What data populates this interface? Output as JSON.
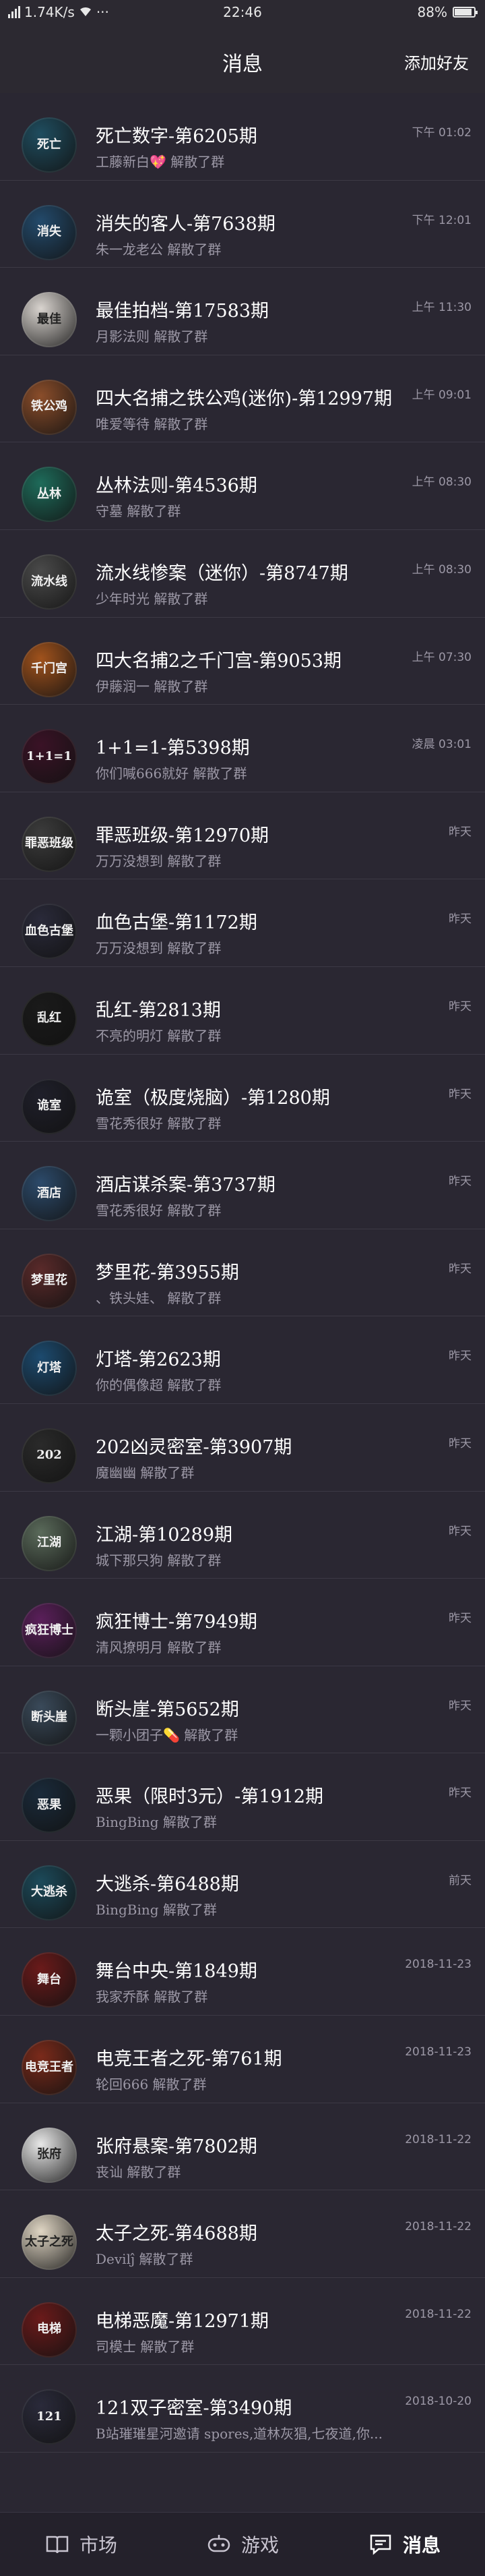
{
  "status_bar": {
    "signal": "ΩΩΩ",
    "speed": "1.74K/s",
    "dots": "···",
    "time": "22:46",
    "battery": "88%",
    "battery_level": 0.88
  },
  "header": {
    "title": "消息",
    "action_label": "添加好友"
  },
  "conversations": [
    {
      "title": "死亡数字-第6205期",
      "message": "工藤新白💖 解散了群",
      "time": "下午 01:02",
      "avatar_text": "死亡",
      "color": "#1f4d5f"
    },
    {
      "title": "消失的客人-第7638期",
      "message": "朱一龙老公 解散了群",
      "time": "下午 12:01",
      "avatar_text": "消失",
      "color": "#234a6b"
    },
    {
      "title": "最佳拍档-第17583期",
      "message": "月影法则 解散了群",
      "time": "上午 11:30",
      "avatar_text": "最佳",
      "color": "#d9d4cf"
    },
    {
      "title": "四大名捕之铁公鸡(迷你)-第12997期",
      "message": "唯爱等待 解散了群",
      "time": "上午 09:01",
      "avatar_text": "铁公鸡",
      "color": "#8a4d2a"
    },
    {
      "title": "丛林法则-第4536期",
      "message": "守墓 解散了群",
      "time": "上午 08:30",
      "avatar_text": "丛林",
      "color": "#1e6b5a"
    },
    {
      "title": "流水线惨案（迷你）-第8747期",
      "message": "少年时光 解散了群",
      "time": "上午 08:30",
      "avatar_text": "流水线",
      "color": "#4a4a4a"
    },
    {
      "title": "四大名捕2之千门宫-第9053期",
      "message": "伊藤润一 解散了群",
      "time": "上午 07:30",
      "avatar_text": "千门宫",
      "color": "#a0521c"
    },
    {
      "title": "1+1=1-第5398期",
      "message": "你们喊666就好 解散了群",
      "time": "凌晨 03:01",
      "avatar_text": "1+1=1",
      "color": "#3a1226"
    },
    {
      "title": "罪恶班级-第12970期",
      "message": "万万没想到 解散了群",
      "time": "昨天",
      "avatar_text": "罪恶班级",
      "color": "#3c3c3c"
    },
    {
      "title": "血色古堡-第1172期",
      "message": "万万没想到 解散了群",
      "time": "昨天",
      "avatar_text": "血色古堡",
      "color": "#2a2a3a"
    },
    {
      "title": "乱红-第2813期",
      "message": "不亮的明灯 解散了群",
      "time": "昨天",
      "avatar_text": "乱红",
      "color": "#1a1a1a"
    },
    {
      "title": "诡室（极度烧脑）-第1280期",
      "message": "雪花秀很好 解散了群",
      "time": "昨天",
      "avatar_text": "诡室",
      "color": "#1f1f2a"
    },
    {
      "title": "酒店谋杀案-第3737期",
      "message": "雪花秀很好 解散了群",
      "time": "昨天",
      "avatar_text": "酒店",
      "color": "#2c4a6a"
    },
    {
      "title": "梦里花-第3955期",
      "message": "、铁头娃、 解散了群",
      "time": "昨天",
      "avatar_text": "梦里花",
      "color": "#5a2a2a"
    },
    {
      "title": "灯塔-第2623期",
      "message": "你的偶像超 解散了群",
      "time": "昨天",
      "avatar_text": "灯塔",
      "color": "#1c4a6e"
    },
    {
      "title": "202凶灵密室-第3907期",
      "message": "魔幽幽 解散了群",
      "time": "昨天",
      "avatar_text": "202",
      "color": "#2a2a2a"
    },
    {
      "title": "江湖-第10289期",
      "message": "城下那只狗 解散了群",
      "time": "昨天",
      "avatar_text": "江湖",
      "color": "#5a6a5a"
    },
    {
      "title": "疯狂博士-第7949期",
      "message": "清风撩明月 解散了群",
      "time": "昨天",
      "avatar_text": "疯狂博士",
      "color": "#5a1f5a"
    },
    {
      "title": "断头崖-第5652期",
      "message": "一颗小团子💊 解散了群",
      "time": "昨天",
      "avatar_text": "断头崖",
      "color": "#3a4a5a"
    },
    {
      "title": "恶果（限时3元）-第1912期",
      "message": "BingBing 解散了群",
      "time": "昨天",
      "avatar_text": "恶果",
      "color": "#1a2a3a"
    },
    {
      "title": "大逃杀-第6488期",
      "message": "BingBing 解散了群",
      "time": "前天",
      "avatar_text": "大逃杀",
      "color": "#1c4a5a"
    },
    {
      "title": "舞台中央-第1849期",
      "message": "我家乔酥 解散了群",
      "time": "2018-11-23",
      "avatar_text": "舞台",
      "color": "#6a1a1a"
    },
    {
      "title": "电竞王者之死-第761期",
      "message": "轮回666 解散了群",
      "time": "2018-11-23",
      "avatar_text": "电竞王者",
      "color": "#7a2a1a"
    },
    {
      "title": "张府悬案-第7802期",
      "message": "丧讪 解散了群",
      "time": "2018-11-22",
      "avatar_text": "张府",
      "color": "#e8e8e8"
    },
    {
      "title": "太子之死-第4688期",
      "message": "Devilĵ 解散了群",
      "time": "2018-11-22",
      "avatar_text": "太子之死",
      "color": "#e0d6c4"
    },
    {
      "title": "电梯恶魔-第12971期",
      "message": "司模士 解散了群",
      "time": "2018-11-22",
      "avatar_text": "电梯",
      "color": "#6a1a1a"
    },
    {
      "title": "121双子密室-第3490期",
      "message": "B站璀璀星河邀请 spores,道林灰猖,七夜道,你...",
      "time": "2018-10-20",
      "avatar_text": "121",
      "color": "#2a2a3a"
    }
  ],
  "tabs": [
    {
      "label": "市场",
      "icon": "book-icon"
    },
    {
      "label": "游戏",
      "icon": "gamepad-icon"
    },
    {
      "label": "消息",
      "icon": "chat-icon"
    }
  ],
  "active_tab": "消息"
}
